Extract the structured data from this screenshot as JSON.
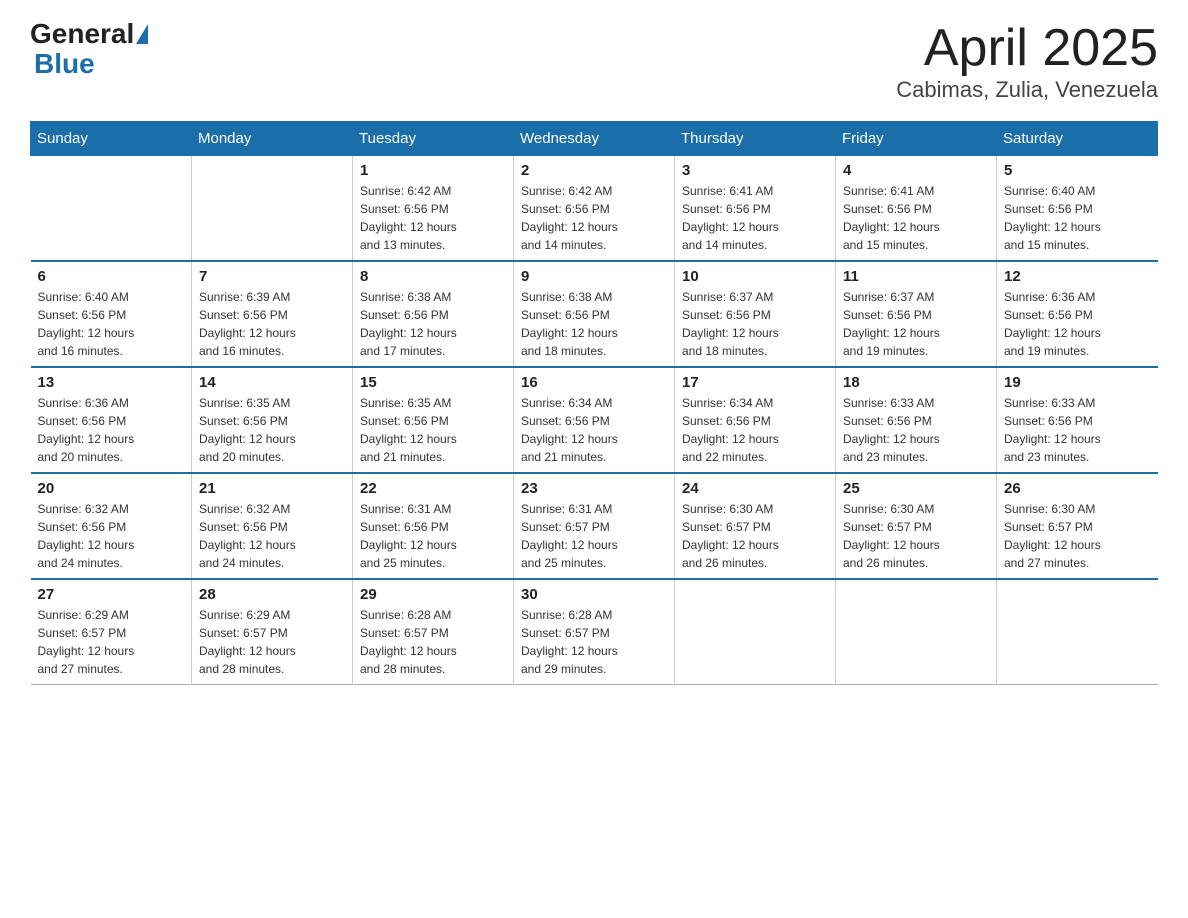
{
  "logo": {
    "general": "General",
    "blue": "Blue"
  },
  "title": "April 2025",
  "subtitle": "Cabimas, Zulia, Venezuela",
  "days_of_week": [
    "Sunday",
    "Monday",
    "Tuesday",
    "Wednesday",
    "Thursday",
    "Friday",
    "Saturday"
  ],
  "weeks": [
    [
      {
        "day": "",
        "info": ""
      },
      {
        "day": "",
        "info": ""
      },
      {
        "day": "1",
        "info": "Sunrise: 6:42 AM\nSunset: 6:56 PM\nDaylight: 12 hours\nand 13 minutes."
      },
      {
        "day": "2",
        "info": "Sunrise: 6:42 AM\nSunset: 6:56 PM\nDaylight: 12 hours\nand 14 minutes."
      },
      {
        "day": "3",
        "info": "Sunrise: 6:41 AM\nSunset: 6:56 PM\nDaylight: 12 hours\nand 14 minutes."
      },
      {
        "day": "4",
        "info": "Sunrise: 6:41 AM\nSunset: 6:56 PM\nDaylight: 12 hours\nand 15 minutes."
      },
      {
        "day": "5",
        "info": "Sunrise: 6:40 AM\nSunset: 6:56 PM\nDaylight: 12 hours\nand 15 minutes."
      }
    ],
    [
      {
        "day": "6",
        "info": "Sunrise: 6:40 AM\nSunset: 6:56 PM\nDaylight: 12 hours\nand 16 minutes."
      },
      {
        "day": "7",
        "info": "Sunrise: 6:39 AM\nSunset: 6:56 PM\nDaylight: 12 hours\nand 16 minutes."
      },
      {
        "day": "8",
        "info": "Sunrise: 6:38 AM\nSunset: 6:56 PM\nDaylight: 12 hours\nand 17 minutes."
      },
      {
        "day": "9",
        "info": "Sunrise: 6:38 AM\nSunset: 6:56 PM\nDaylight: 12 hours\nand 18 minutes."
      },
      {
        "day": "10",
        "info": "Sunrise: 6:37 AM\nSunset: 6:56 PM\nDaylight: 12 hours\nand 18 minutes."
      },
      {
        "day": "11",
        "info": "Sunrise: 6:37 AM\nSunset: 6:56 PM\nDaylight: 12 hours\nand 19 minutes."
      },
      {
        "day": "12",
        "info": "Sunrise: 6:36 AM\nSunset: 6:56 PM\nDaylight: 12 hours\nand 19 minutes."
      }
    ],
    [
      {
        "day": "13",
        "info": "Sunrise: 6:36 AM\nSunset: 6:56 PM\nDaylight: 12 hours\nand 20 minutes."
      },
      {
        "day": "14",
        "info": "Sunrise: 6:35 AM\nSunset: 6:56 PM\nDaylight: 12 hours\nand 20 minutes."
      },
      {
        "day": "15",
        "info": "Sunrise: 6:35 AM\nSunset: 6:56 PM\nDaylight: 12 hours\nand 21 minutes."
      },
      {
        "day": "16",
        "info": "Sunrise: 6:34 AM\nSunset: 6:56 PM\nDaylight: 12 hours\nand 21 minutes."
      },
      {
        "day": "17",
        "info": "Sunrise: 6:34 AM\nSunset: 6:56 PM\nDaylight: 12 hours\nand 22 minutes."
      },
      {
        "day": "18",
        "info": "Sunrise: 6:33 AM\nSunset: 6:56 PM\nDaylight: 12 hours\nand 23 minutes."
      },
      {
        "day": "19",
        "info": "Sunrise: 6:33 AM\nSunset: 6:56 PM\nDaylight: 12 hours\nand 23 minutes."
      }
    ],
    [
      {
        "day": "20",
        "info": "Sunrise: 6:32 AM\nSunset: 6:56 PM\nDaylight: 12 hours\nand 24 minutes."
      },
      {
        "day": "21",
        "info": "Sunrise: 6:32 AM\nSunset: 6:56 PM\nDaylight: 12 hours\nand 24 minutes."
      },
      {
        "day": "22",
        "info": "Sunrise: 6:31 AM\nSunset: 6:56 PM\nDaylight: 12 hours\nand 25 minutes."
      },
      {
        "day": "23",
        "info": "Sunrise: 6:31 AM\nSunset: 6:57 PM\nDaylight: 12 hours\nand 25 minutes."
      },
      {
        "day": "24",
        "info": "Sunrise: 6:30 AM\nSunset: 6:57 PM\nDaylight: 12 hours\nand 26 minutes."
      },
      {
        "day": "25",
        "info": "Sunrise: 6:30 AM\nSunset: 6:57 PM\nDaylight: 12 hours\nand 26 minutes."
      },
      {
        "day": "26",
        "info": "Sunrise: 6:30 AM\nSunset: 6:57 PM\nDaylight: 12 hours\nand 27 minutes."
      }
    ],
    [
      {
        "day": "27",
        "info": "Sunrise: 6:29 AM\nSunset: 6:57 PM\nDaylight: 12 hours\nand 27 minutes."
      },
      {
        "day": "28",
        "info": "Sunrise: 6:29 AM\nSunset: 6:57 PM\nDaylight: 12 hours\nand 28 minutes."
      },
      {
        "day": "29",
        "info": "Sunrise: 6:28 AM\nSunset: 6:57 PM\nDaylight: 12 hours\nand 28 minutes."
      },
      {
        "day": "30",
        "info": "Sunrise: 6:28 AM\nSunset: 6:57 PM\nDaylight: 12 hours\nand 29 minutes."
      },
      {
        "day": "",
        "info": ""
      },
      {
        "day": "",
        "info": ""
      },
      {
        "day": "",
        "info": ""
      }
    ]
  ]
}
